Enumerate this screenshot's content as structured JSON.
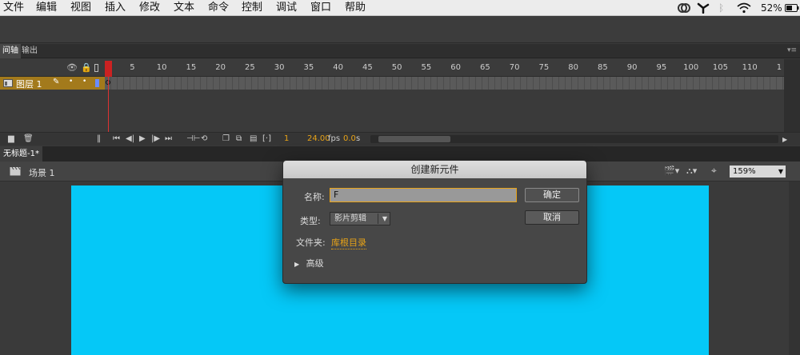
{
  "menu": [
    "文件",
    "编辑",
    "视图",
    "插入",
    "修改",
    "文本",
    "命令",
    "控制",
    "调试",
    "窗口",
    "帮助"
  ],
  "status": {
    "battery": "52%"
  },
  "timeline": {
    "tabs": [
      "间轴",
      "输出"
    ],
    "ruler_ticks": [
      "1",
      "5",
      "10",
      "15",
      "20",
      "25",
      "30",
      "35",
      "40",
      "45",
      "50",
      "55",
      "60",
      "65",
      "70",
      "75",
      "80",
      "85",
      "90",
      "95",
      "100",
      "105",
      "110",
      "1"
    ],
    "layer_name": "图层 1",
    "current_frame": "1",
    "fps_value": "24.00",
    "fps_unit": "fps",
    "time_value": "0.0",
    "time_unit": "s"
  },
  "document": {
    "tab_title": "无标题-1*",
    "scene": "场景 1",
    "zoom": "159%",
    "stage_color": "#05c8f7"
  },
  "dialog": {
    "title": "创建新元件",
    "name_label": "名称:",
    "name_value": "F",
    "type_label": "类型:",
    "type_value": "影片剪辑",
    "folder_label": "文件夹:",
    "folder_value": "库根目录",
    "advanced_label": "高级",
    "ok_label": "确定",
    "cancel_label": "取消"
  },
  "colors": {
    "accent": "#e8a317",
    "layer_highlight": "#a37a1c",
    "playhead": "#cc2222"
  }
}
